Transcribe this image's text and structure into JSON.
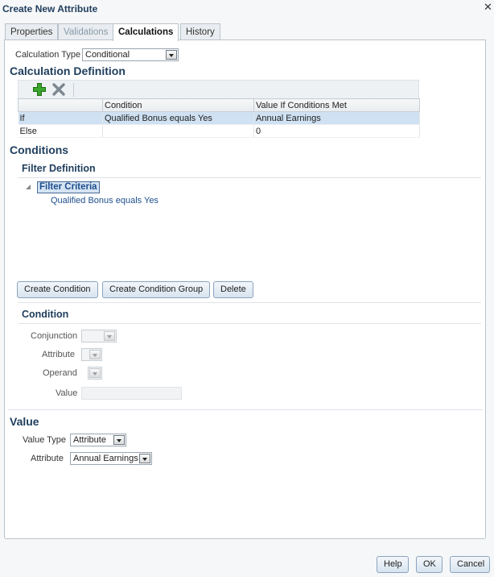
{
  "dialog": {
    "title": "Create New Attribute"
  },
  "icons": {
    "close": "close-icon",
    "add": "add-icon",
    "delete": "delete-icon",
    "dropdown": "chevron-down-icon",
    "collapse": "collapse-triangle-icon"
  },
  "colors": {
    "heading": "#1e3d5c",
    "selection": "#cfe1f2",
    "link": "#1e4e8c"
  },
  "tabs": [
    {
      "label": "Properties",
      "state": "enabled"
    },
    {
      "label": "Validations",
      "state": "disabled"
    },
    {
      "label": "Calculations",
      "state": "active"
    },
    {
      "label": "History",
      "state": "enabled"
    }
  ],
  "calc_type": {
    "label": "Calculation Type",
    "value": "Conditional"
  },
  "calc_def": {
    "heading": "Calculation Definition",
    "columns": [
      "",
      "Condition",
      "Value If Conditions Met"
    ],
    "rows": [
      {
        "type": "If",
        "condition": "Qualified Bonus equals Yes",
        "value": "Annual Earnings"
      },
      {
        "type": "Else",
        "condition": "",
        "value": "0"
      }
    ]
  },
  "conditions": {
    "heading": "Conditions",
    "filter_heading": "Filter Definition",
    "tree_root": "Filter Criteria",
    "tree_child": "Qualified Bonus equals Yes",
    "buttons": {
      "create_condition": "Create Condition",
      "create_group": "Create Condition Group",
      "delete": "Delete"
    }
  },
  "condition_form": {
    "heading": "Condition",
    "conjunction_label": "Conjunction",
    "attribute_label": "Attribute",
    "operand_label": "Operand",
    "value_label": "Value"
  },
  "value_section": {
    "heading": "Value",
    "value_type_label": "Value Type",
    "value_type": "Attribute",
    "attribute_label": "Attribute",
    "attribute_value": "Annual Earnings"
  },
  "footer": {
    "help": "Help",
    "ok": "OK",
    "cancel": "Cancel"
  }
}
